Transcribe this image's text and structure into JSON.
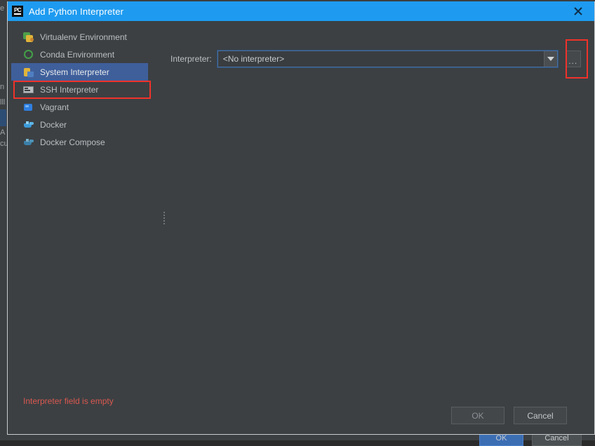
{
  "window": {
    "title": "Add Python Interpreter",
    "app_icon": "pycharm-logo-icon",
    "close_icon": "close-icon",
    "titlebar_color": "#1e9bf0"
  },
  "sidebar": {
    "items": [
      {
        "label": "Virtualenv Environment",
        "icon": "virtualenv-icon",
        "selected": false
      },
      {
        "label": "Conda Environment",
        "icon": "conda-icon",
        "selected": false
      },
      {
        "label": "System Interpreter",
        "icon": "python-icon",
        "selected": true
      },
      {
        "label": "SSH Interpreter",
        "icon": "ssh-monitor-icon",
        "selected": false
      },
      {
        "label": "Vagrant",
        "icon": "vagrant-icon",
        "selected": false
      },
      {
        "label": "Docker",
        "icon": "docker-whale-icon",
        "selected": false
      },
      {
        "label": "Docker Compose",
        "icon": "docker-compose-icon",
        "selected": false
      }
    ]
  },
  "main": {
    "interpreter_label": "Interpreter:",
    "interpreter_value": "<No interpreter>",
    "interpreter_placeholder": "<No interpreter>",
    "dropdown_icon": "chevron-down-icon",
    "browse_button_label": "...",
    "error_message": "Interpreter field is empty",
    "error_color": "#d9584f"
  },
  "footer": {
    "ok_label": "OK",
    "cancel_label": "Cancel"
  },
  "annotations": {
    "highlight_color": "#f0322a",
    "boxes": [
      {
        "target": "System Interpreter sidebar item"
      },
      {
        "target": "Browse (...) button"
      }
    ]
  },
  "background": {
    "fragments": [
      "e",
      "n",
      "lll",
      "cu",
      "A"
    ],
    "buttons": [
      {
        "label": "OK",
        "style": "primary"
      },
      {
        "label": "Cancel",
        "style": "plain"
      }
    ]
  }
}
